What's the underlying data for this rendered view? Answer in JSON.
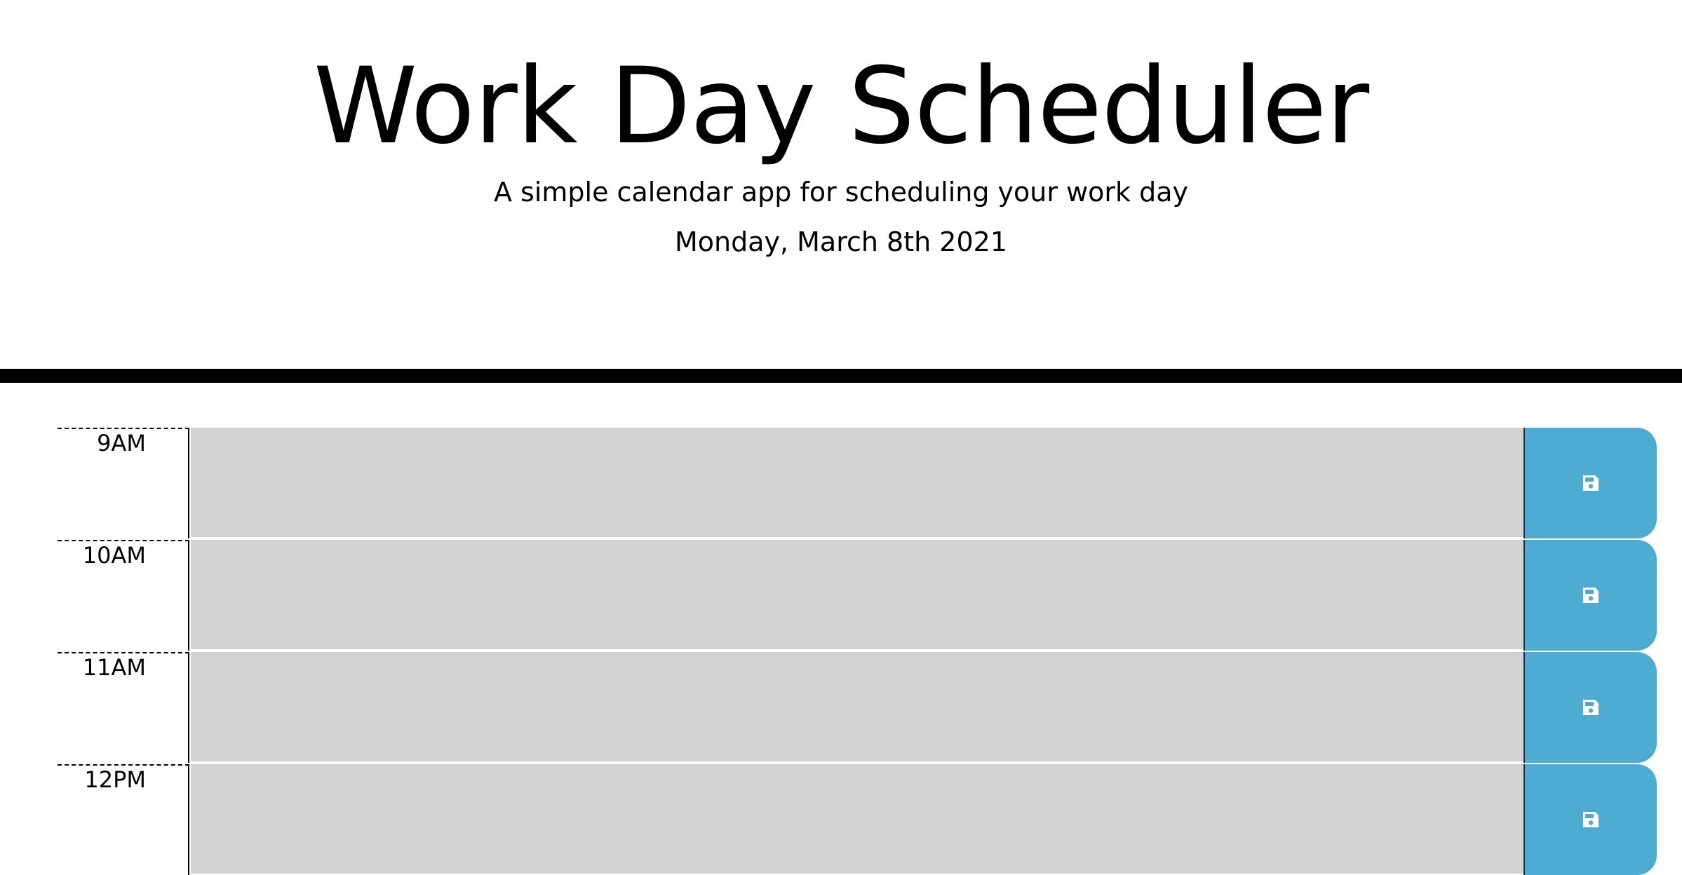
{
  "header": {
    "title": "Work Day Scheduler",
    "subtitle": "A simple calendar app for scheduling your work day",
    "current_date": "Monday, March 8th 2021"
  },
  "timeblocks": [
    {
      "hour": "9AM",
      "description": "",
      "save_icon": "save-icon"
    },
    {
      "hour": "10AM",
      "description": "",
      "save_icon": "save-icon"
    },
    {
      "hour": "11AM",
      "description": "",
      "save_icon": "save-icon"
    },
    {
      "hour": "12PM",
      "description": "",
      "save_icon": "save-icon"
    }
  ],
  "colors": {
    "past": "#d3d3d3",
    "save_button": "#4eabd2",
    "divider": "#000000"
  }
}
